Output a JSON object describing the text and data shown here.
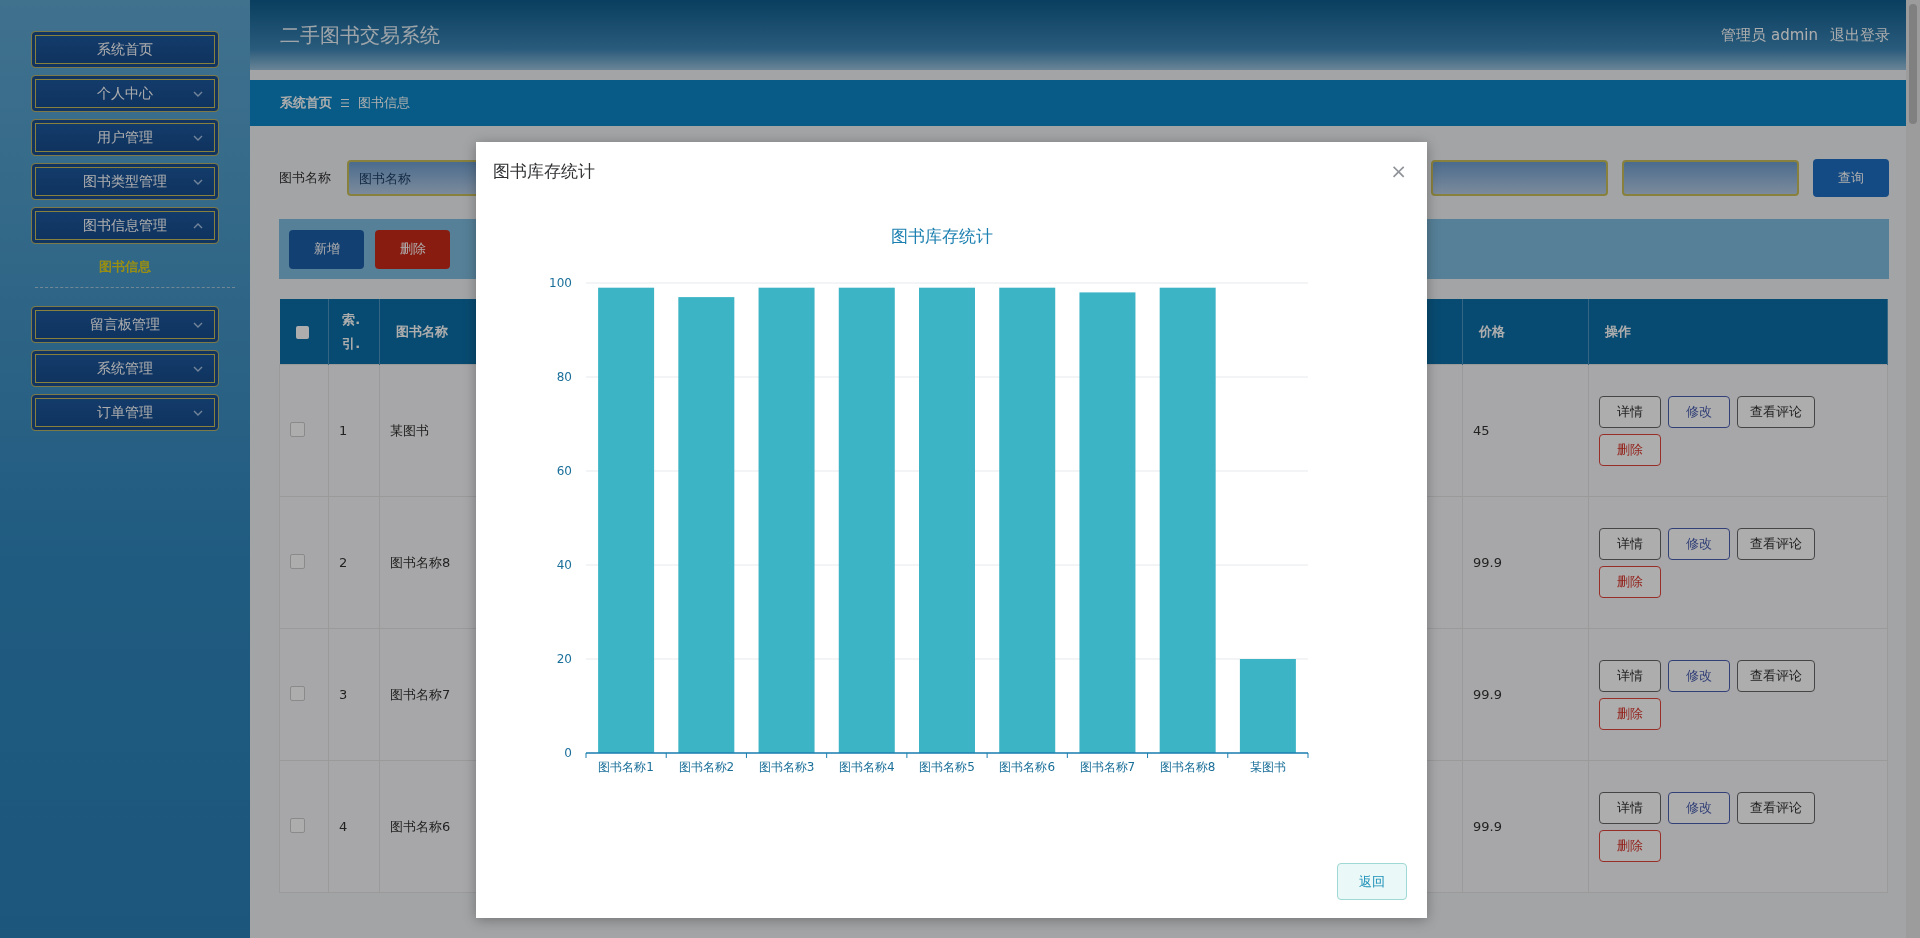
{
  "header": {
    "title": "二手图书交易系统",
    "user": "管理员 admin",
    "logout": "退出登录"
  },
  "sidebar": {
    "items": [
      {
        "label": "系统首页",
        "kind": "link"
      },
      {
        "label": "个人中心",
        "kind": "menu",
        "expanded": false
      },
      {
        "label": "用户管理",
        "kind": "menu",
        "expanded": false
      },
      {
        "label": "图书类型管理",
        "kind": "menu",
        "expanded": false
      },
      {
        "label": "图书信息管理",
        "kind": "menu",
        "expanded": true,
        "children": [
          {
            "label": "图书信息",
            "selected": true
          }
        ]
      },
      {
        "label": "留言板管理",
        "kind": "menu",
        "expanded": false
      },
      {
        "label": "系统管理",
        "kind": "menu",
        "expanded": false
      },
      {
        "label": "订单管理",
        "kind": "menu",
        "expanded": false
      }
    ]
  },
  "breadcrumb": [
    "系统首页",
    "图书信息"
  ],
  "search": {
    "label": "图书名称",
    "name_field": {
      "placeholder": "图书名称"
    },
    "button": "查询"
  },
  "actions": [
    {
      "label": "新增",
      "kind": "add"
    },
    {
      "label": "删除",
      "kind": "delete"
    }
  ],
  "table": {
    "header_checkbox": {
      "checked": false
    },
    "columns": [
      "索.引.",
      "图书名称",
      "价格",
      "操作"
    ],
    "rows": [
      {
        "checked": false,
        "index": "1",
        "name": "某图书",
        "price": "45",
        "actions": [
          {
            "label": "详情",
            "kind": "plain"
          },
          {
            "label": "修改",
            "kind": "edit"
          },
          {
            "label": "查看评论",
            "kind": "plain"
          },
          {
            "label": "删除",
            "kind": "delete"
          }
        ]
      },
      {
        "checked": false,
        "index": "2",
        "name": "图书名称8",
        "price": "99.9",
        "actions": [
          {
            "label": "详情",
            "kind": "plain"
          },
          {
            "label": "修改",
            "kind": "edit"
          },
          {
            "label": "查看评论",
            "kind": "plain"
          },
          {
            "label": "删除",
            "kind": "delete"
          }
        ]
      },
      {
        "checked": false,
        "index": "3",
        "name": "图书名称7",
        "price": "99.9",
        "actions": [
          {
            "label": "详情",
            "kind": "plain"
          },
          {
            "label": "修改",
            "kind": "edit"
          },
          {
            "label": "查看评论",
            "kind": "plain"
          },
          {
            "label": "删除",
            "kind": "delete"
          }
        ]
      },
      {
        "checked": false,
        "index": "4",
        "name": "图书名称6",
        "price": "99.9",
        "actions": [
          {
            "label": "详情",
            "kind": "plain"
          },
          {
            "label": "修改",
            "kind": "edit"
          },
          {
            "label": "查看评论",
            "kind": "plain"
          },
          {
            "label": "删除",
            "kind": "delete"
          }
        ]
      }
    ]
  },
  "modal": {
    "title": "图书库存统计",
    "close": "×",
    "back_button": "返回",
    "chart_data": {
      "type": "bar",
      "title": "图书库存统计",
      "categories": [
        "图书名称1",
        "图书名称2",
        "图书名称3",
        "图书名称4",
        "图书名称5",
        "图书名称6",
        "图书名称7",
        "图书名称8",
        "某图书"
      ],
      "values": [
        99,
        97,
        99,
        99,
        99,
        99,
        98,
        99,
        20
      ],
      "ylim": [
        0,
        100
      ],
      "yticks": [
        0,
        20,
        40,
        60,
        80,
        100
      ],
      "grid": true
    }
  }
}
